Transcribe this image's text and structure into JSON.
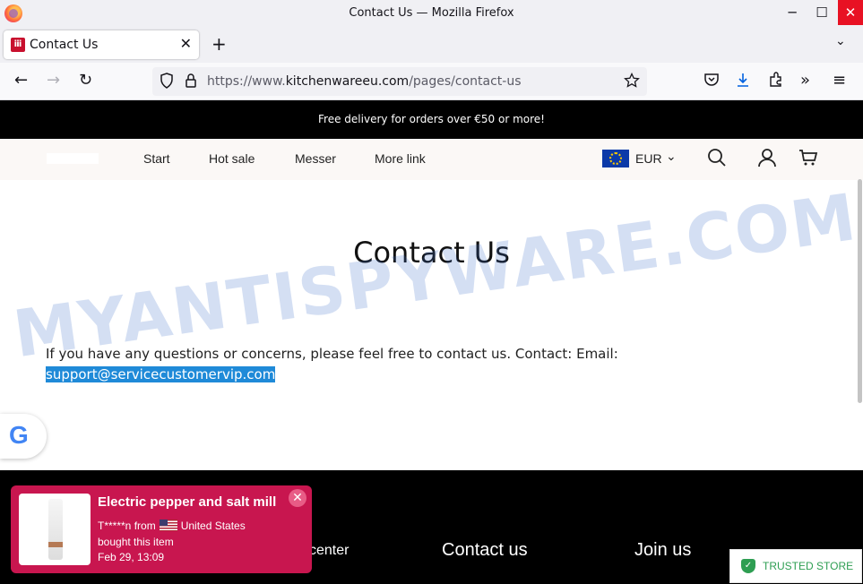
{
  "window": {
    "title": "Contact Us — Mozilla Firefox",
    "minimize": "─",
    "maximize": "☐",
    "close": "✕"
  },
  "tabs": [
    {
      "label": "Contact Us",
      "favicon": "zwilling-favicon",
      "close": "✕"
    }
  ],
  "tabstrip": {
    "new_tab": "+",
    "list_all": "⌄"
  },
  "navbar": {
    "back": "←",
    "forward": "→",
    "reload": "↻",
    "url_prefix": "https://www.",
    "url_host": "kitchenwareeu.com",
    "url_path": "/pages/contact-us",
    "icons": [
      "pocket-icon",
      "download-icon",
      "extensions-icon",
      "overflow-icon",
      "menu-icon"
    ]
  },
  "announcement": "Free delivery for orders over €50 or more!",
  "site_nav": {
    "items": [
      "Start",
      "Hot sale",
      "Messer",
      "More link"
    ],
    "currency": "EUR"
  },
  "contact": {
    "title": "Contact Us",
    "body": "If you have any questions or concerns, please feel free to contact us. Contact: Email:",
    "email": "support@servicecustomervip.com"
  },
  "watermark": "MYANTISPYWARE.COM",
  "footer": {
    "partial": "center",
    "contact_heading": "Contact us",
    "join_heading": "Join us"
  },
  "popup": {
    "product": "Electric pepper and salt mill",
    "buyer": "T*****n from",
    "country": "United States",
    "action": "bought this item",
    "time": "Feb 29, 13:09",
    "close": "✕"
  },
  "trust_badge": "TRUSTED STORE",
  "colors": {
    "popup_bg": "#c8164f",
    "trusted_green": "#2e9e52",
    "selection": "#1f8ad8"
  }
}
